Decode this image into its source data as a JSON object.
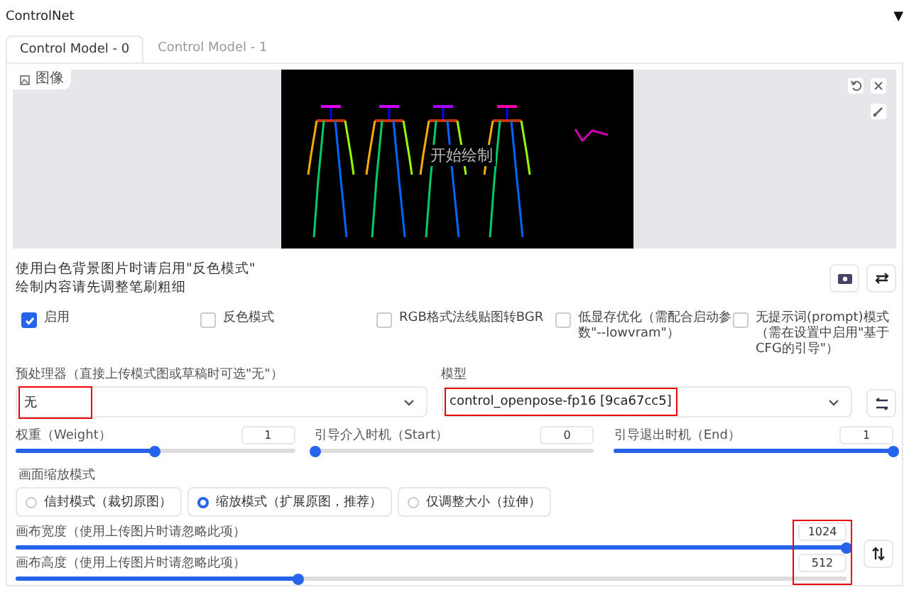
{
  "panel": {
    "title": "ControlNet",
    "toggle": "▼"
  },
  "tabs": [
    {
      "label": "Control Model - 0",
      "selected": true
    },
    {
      "label": "Control Model - 1",
      "selected": false
    }
  ],
  "image": {
    "label": "图像",
    "hint": "开始绘制",
    "kind": "picture"
  },
  "notes": [
    "使用白色背景图片时请启用\"反色模式\"",
    "绘制内容请先调整笔刷粗细"
  ],
  "options": [
    {
      "label": "启用",
      "checked": true
    },
    {
      "label": "反色模式",
      "checked": false
    },
    {
      "label": "RGB格式法线贴图转BGR",
      "checked": false
    },
    {
      "label": "低显存优化（需配合启动参数\"--lowvram\"）",
      "checked": false
    },
    {
      "label": "无提示词(prompt)模式（需在设置中启用\"基于CFG的引导\"）",
      "checked": false
    }
  ],
  "preprocessor": {
    "label": "预处理器（直接上传模式图或草稿时可选\"无\"）",
    "value": "无",
    "highlighted": true
  },
  "model": {
    "label": "模型",
    "value": "control_openpose-fp16 [9ca67cc5]",
    "highlighted": true
  },
  "sliders": [
    {
      "label": "权重（Weight）",
      "reading": "1",
      "level": 0.5
    },
    {
      "label": "引导介入时机（Start）",
      "reading": "0",
      "level": 0
    },
    {
      "label": "引导退出时机（End）",
      "reading": "1",
      "level": 1
    }
  ],
  "resize_mode": {
    "label": "画面缩放模式",
    "options": [
      {
        "label": "信封模式（裁切原图）",
        "selected": false
      },
      {
        "label": "缩放模式（扩展原图，推荐）",
        "selected": true
      },
      {
        "label": "仅调整大小（拉伸）",
        "selected": false
      }
    ]
  },
  "canvas": {
    "highlighted": true,
    "sliders": [
      {
        "label": "画布宽度（使用上传图片时请忽略此项）",
        "reading": "1024",
        "level": 1
      },
      {
        "label": "画布高度（使用上传图片时请忽略此项）",
        "reading": "512",
        "level": 0.34
      }
    ]
  }
}
